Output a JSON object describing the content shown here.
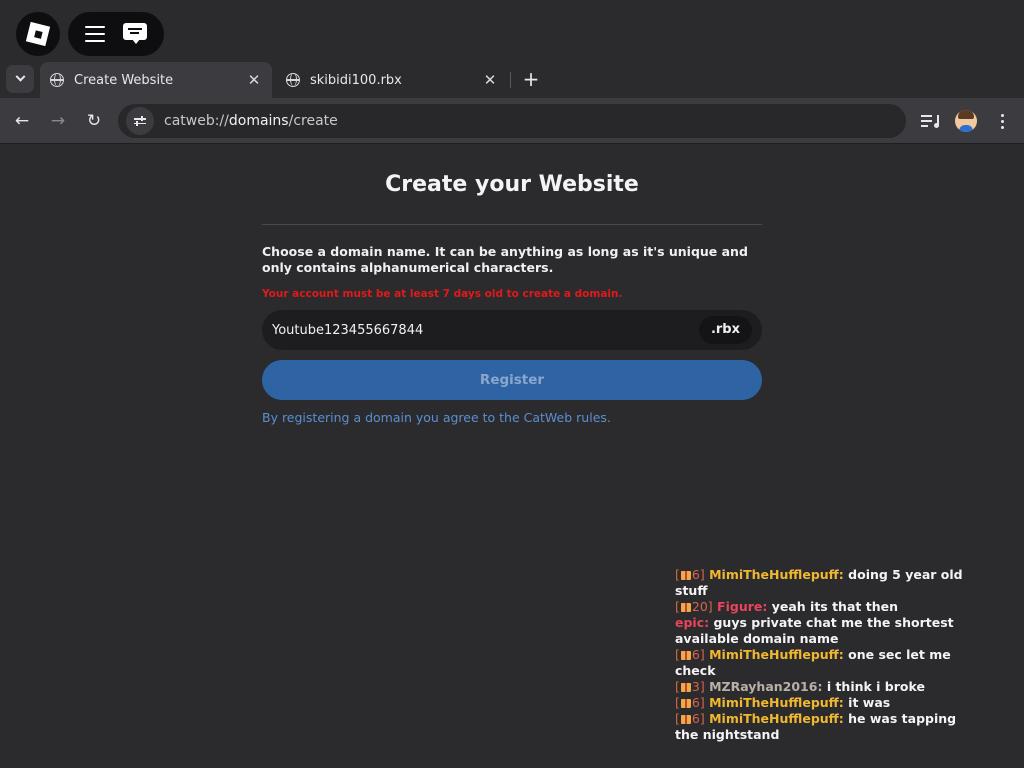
{
  "browser": {
    "tabs": [
      {
        "title": "Create Website",
        "active": true
      },
      {
        "title": "skibidi100.rbx",
        "active": false
      }
    ],
    "close_glyph": "✕",
    "new_tab_glyph": "+",
    "url_scheme": "catweb://",
    "url_host": "domains",
    "url_path": "/create",
    "back_glyph": "←",
    "forward_glyph": "→",
    "reload_glyph": "↻"
  },
  "page": {
    "title": "Create your Website",
    "instructions": "Choose a domain name. It can be anything as long as it's unique and only contains alphanumerical characters.",
    "error": "Your account must be at least 7 days old to create a domain.",
    "domain_value": "Youtube123455667844",
    "tld": ".rbx",
    "register_label": "Register",
    "rules_text": "By registering a domain you agree to the CatWeb rules."
  },
  "colors": {
    "background": "#2b2b2e",
    "accent_button": "#2f64a4",
    "link": "#5a8fd0",
    "error": "#e01a1a",
    "chat_name_gold": "#f0b830",
    "chat_name_red": "#e8445a",
    "chat_name_gray": "#b9b0a6"
  },
  "chat": [
    {
      "tag_open": "[",
      "level": "6]",
      "name": "MimiTheHufflepuff:",
      "name_color": "#f0b830",
      "message": "doing 5 year old stuff",
      "gift": true
    },
    {
      "tag_open": "[",
      "level": "20]",
      "name": "Figure:",
      "name_color": "#e8445a",
      "message": "yeah its that then",
      "gift": true
    },
    {
      "tag_open": "",
      "level": "",
      "name": "epic:",
      "name_color": "#e8445a",
      "message": "guys private chat me the shortest available domain name",
      "gift": false
    },
    {
      "tag_open": "[",
      "level": "6]",
      "name": "MimiTheHufflepuff:",
      "name_color": "#f0b830",
      "message": "one sec let me check",
      "gift": true
    },
    {
      "tag_open": "[",
      "level": "3]",
      "name": "MZRayhan2016:",
      "name_color": "#b9b0a6",
      "message": "i think i broke",
      "gift": true
    },
    {
      "tag_open": "[",
      "level": "6]",
      "name": "MimiTheHufflepuff:",
      "name_color": "#f0b830",
      "message": "it was",
      "gift": true
    },
    {
      "tag_open": "[",
      "level": "6]",
      "name": "MimiTheHufflepuff:",
      "name_color": "#f0b830",
      "message": "he was tapping the nightstand",
      "gift": true
    }
  ]
}
